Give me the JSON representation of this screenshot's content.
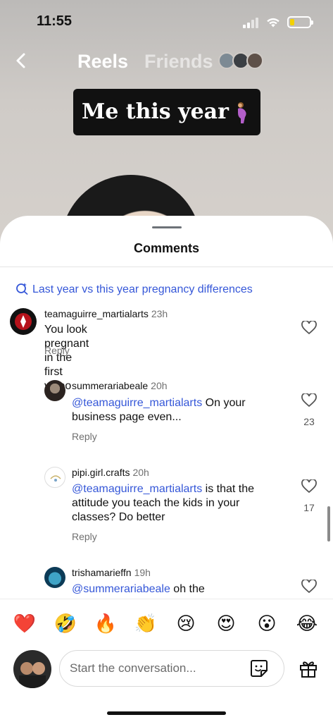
{
  "status_bar": {
    "time": "11:55"
  },
  "nav": {
    "reels_label": "Reels",
    "friends_label": "Friends"
  },
  "video": {
    "caption_text": "Me this year"
  },
  "comments_sheet": {
    "title": "Comments",
    "suggestion": "Last year vs this year pregnancy differences",
    "reply_label": "Reply",
    "comments": [
      {
        "username": "teamaguirre_martialarts",
        "time": "23h",
        "text_line1": "You look pregnant in the first video"
      },
      {
        "username": "summeraria beale",
        "username_display": "summerariabeale",
        "time": "20h",
        "mention": "@teamaguirre_martialarts",
        "text_after_mention": " On your",
        "text_line2": "business page even...",
        "likes": "23"
      },
      {
        "username_display": "pipi.girl.crafts",
        "time": "20h",
        "mention": "@teamaguirre_martialarts",
        "text_after_mention": " is that the",
        "text_line2": "attitude you teach the kids in your",
        "text_line3": "classes? Do better",
        "likes": "17"
      },
      {
        "username_display": "trishamarieffn",
        "time": "19h",
        "mention": "@summerariabeale",
        "text_after_mention": " oh the"
      }
    ]
  },
  "emoji_bar": [
    "❤️",
    "🤣",
    "🔥",
    "👏",
    "😢",
    "😍",
    "😮",
    "😂"
  ],
  "composer": {
    "placeholder": "Start the conversation..."
  },
  "colors": {
    "mention": "#3557d8",
    "battery": "#f3d100"
  }
}
